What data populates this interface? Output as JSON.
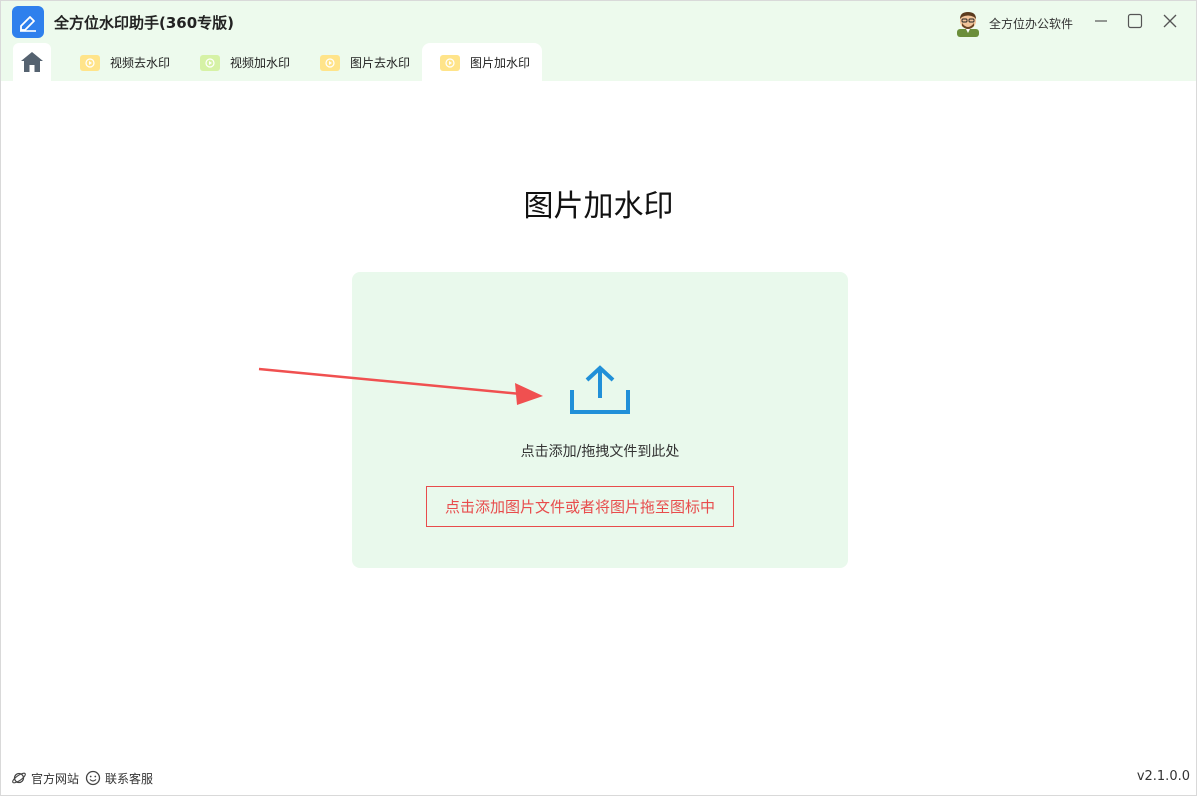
{
  "app": {
    "title": "全方位水印助手(360专版)",
    "user_name": "全方位办公软件"
  },
  "tabs": [
    {
      "label": "视频去水印",
      "icon": "video-icon",
      "active": false
    },
    {
      "label": "视频加水印",
      "icon": "video-icon",
      "active": false
    },
    {
      "label": "图片去水印",
      "icon": "video-icon",
      "active": false
    },
    {
      "label": "图片加水印",
      "icon": "video-icon",
      "active": true
    }
  ],
  "main": {
    "title": "图片加水印",
    "drop_text": "点击添加/拖拽文件到此处",
    "hint": "点击添加图片文件或者将图片拖至图标中"
  },
  "footer": {
    "website_label": "官方网站",
    "support_label": "联系客服",
    "version": "v2.1.0.0"
  },
  "colors": {
    "titlebar_bg": "#edfaed",
    "dropzone_bg": "#e9f9ec",
    "accent_blue": "#2190d8",
    "hint_red": "#e84c4c",
    "tab_icon_yellow": "#ffe48a",
    "tab_icon_green": "#d6f2a6"
  }
}
